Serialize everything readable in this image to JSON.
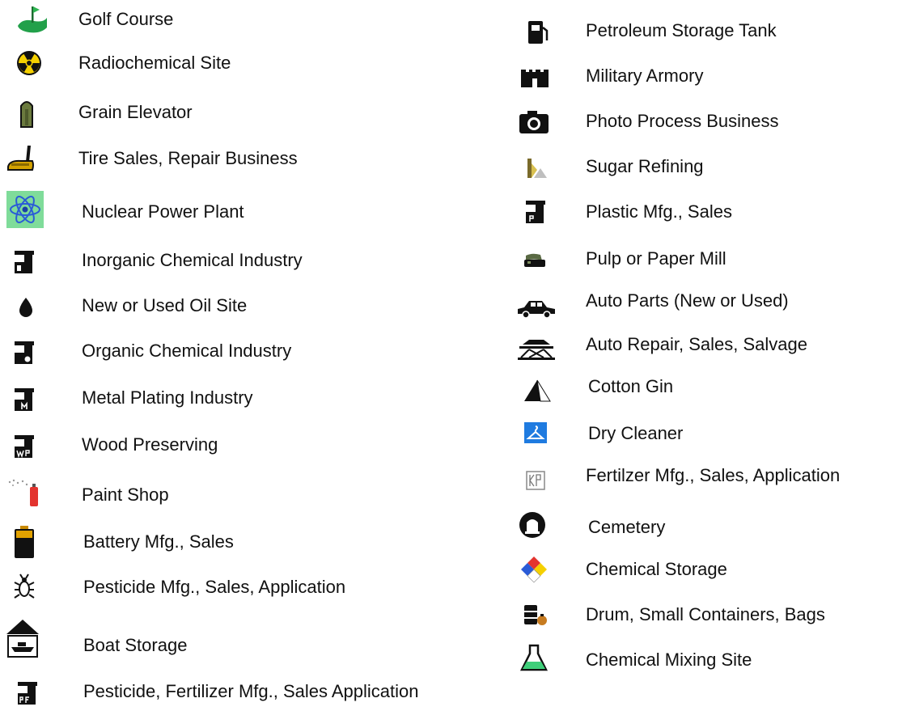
{
  "legend": {
    "left": [
      {
        "label": "Golf Course",
        "icon": "golf-course-icon"
      },
      {
        "label": "Radiochemical Site",
        "icon": "radiation-icon"
      },
      {
        "label": "Grain Elevator",
        "icon": "grain-elevator-icon"
      },
      {
        "label": "Tire Sales, Repair Business",
        "icon": "tire-icon"
      },
      {
        "label": "Nuclear Power Plant",
        "icon": "atom-icon"
      },
      {
        "label": "Inorganic Chemical Industry",
        "icon": "factory-icon"
      },
      {
        "label": "New or Used Oil Site",
        "icon": "oil-drop-icon"
      },
      {
        "label": "Organic Chemical Industry",
        "icon": "factory-o-icon"
      },
      {
        "label": "Metal Plating Industry",
        "icon": "factory-m-icon"
      },
      {
        "label": "Wood Preserving",
        "icon": "factory-wp-icon"
      },
      {
        "label": "Paint Shop",
        "icon": "spray-can-icon"
      },
      {
        "label": "Battery Mfg., Sales",
        "icon": "battery-icon"
      },
      {
        "label": "Pesticide Mfg., Sales, Application",
        "icon": "bug-icon"
      },
      {
        "label": "Boat Storage",
        "icon": "boat-storage-icon"
      },
      {
        "label": "Pesticide, Fertilizer Mfg., Sales Application",
        "icon": "factory-pf-icon"
      }
    ],
    "right": [
      {
        "label": "Petroleum Storage Tank",
        "icon": "fuel-pump-icon"
      },
      {
        "label": "Military Armory",
        "icon": "castle-icon"
      },
      {
        "label": "Photo Process Business",
        "icon": "camera-icon"
      },
      {
        "label": "Sugar Refining",
        "icon": "sugar-icon"
      },
      {
        "label": "Plastic Mfg., Sales",
        "icon": "factory-p-icon"
      },
      {
        "label": "Pulp or Paper Mill",
        "icon": "paper-mill-icon"
      },
      {
        "label": "Auto Parts (New or Used)",
        "icon": "car-icon"
      },
      {
        "label": "Auto Repair, Sales, Salvage",
        "icon": "car-lift-icon"
      },
      {
        "label": "Cotton Gin",
        "icon": "triangle-icon"
      },
      {
        "label": "Dry Cleaner",
        "icon": "hanger-icon"
      },
      {
        "label": "Fertilzer Mfg., Sales, Application",
        "icon": "fertilizer-icon"
      },
      {
        "label": "Cemetery",
        "icon": "tombstone-icon"
      },
      {
        "label": "Chemical Storage",
        "icon": "hazard-diamond-icon"
      },
      {
        "label": "Drum, Small Containers, Bags",
        "icon": "drums-icon"
      },
      {
        "label": "Chemical Mixing Site",
        "icon": "flask-icon"
      }
    ]
  }
}
